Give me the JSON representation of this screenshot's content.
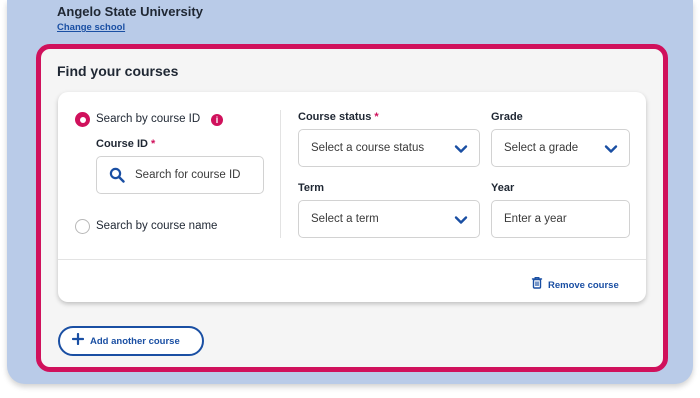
{
  "school": {
    "name": "Angelo State University",
    "change_link": "Change school"
  },
  "section": {
    "title": "Find your courses"
  },
  "search_mode": {
    "by_id_label": "Search by course ID",
    "by_id_selected": true,
    "by_name_label": "Search by course name",
    "info_icon": "i"
  },
  "course_id": {
    "label": "Course ID",
    "required_mark": "*",
    "placeholder": "Search for course ID"
  },
  "course_status": {
    "label": "Course status",
    "required_mark": "*",
    "value": "Select a course status"
  },
  "grade": {
    "label": "Grade",
    "value": "Select a grade"
  },
  "term": {
    "label": "Term",
    "value": "Select a term"
  },
  "year": {
    "label": "Year",
    "placeholder": "Enter a year"
  },
  "actions": {
    "remove_course": "Remove course",
    "add_course": "Add another course"
  },
  "colors": {
    "accent": "#d0115c",
    "link": "#1a4fa3",
    "frame_bg": "#b9cbe8"
  }
}
